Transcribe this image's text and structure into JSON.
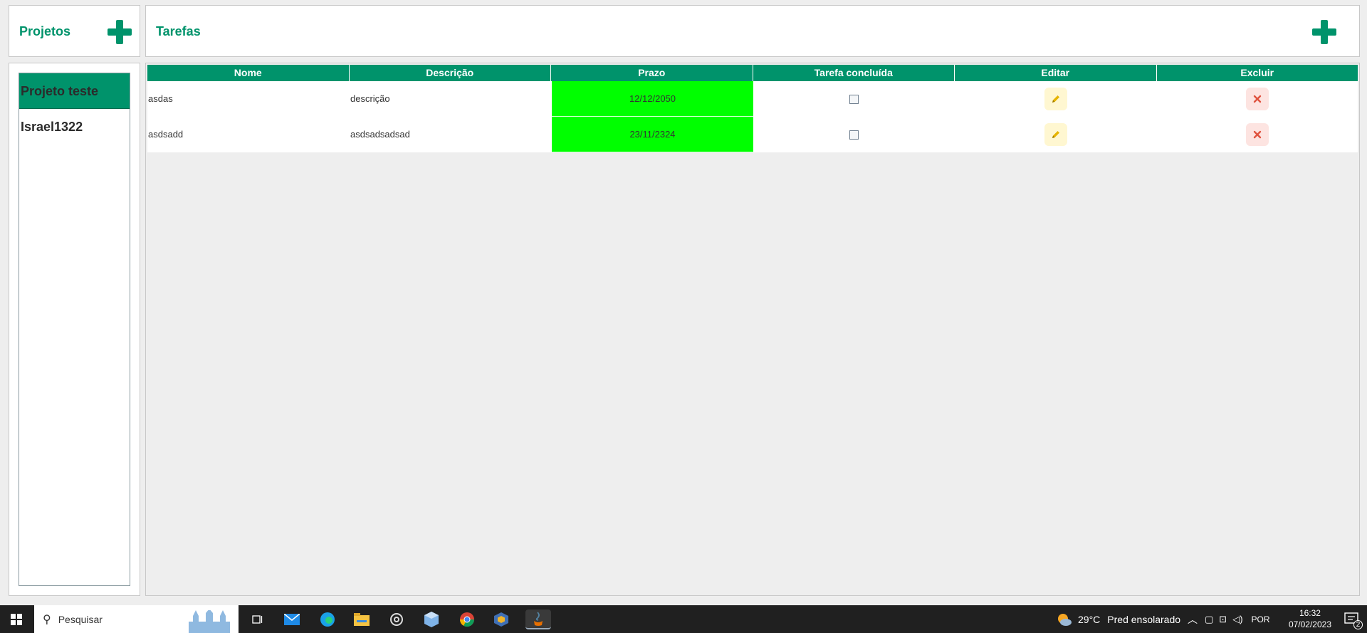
{
  "projects_panel": {
    "title": "Projetos",
    "items": [
      {
        "label": "Projeto teste",
        "selected": true
      },
      {
        "label": "Israel1322",
        "selected": false
      }
    ]
  },
  "tasks_panel": {
    "title": "Tarefas",
    "columns": [
      "Nome",
      "Descrição",
      "Prazo",
      "Tarefa concluída",
      "Editar",
      "Excluir"
    ],
    "rows": [
      {
        "name": "asdas",
        "description": "descrição",
        "deadline": "12/12/2050",
        "done": false
      },
      {
        "name": "asdsadd",
        "description": "asdsadsadsad",
        "deadline": "23/11/2324",
        "done": false
      }
    ]
  },
  "taskbar": {
    "search_placeholder": "Pesquisar",
    "weather_temp": "29°C",
    "weather_desc": "Pred ensolarado",
    "language": "POR",
    "time": "16:32",
    "date": "07/02/2023",
    "notification_count": "2"
  },
  "colors": {
    "accent": "#00936b",
    "deadline_ok": "#00ff00",
    "edit_icon": "#d2a400",
    "delete_icon": "#e0533f"
  }
}
